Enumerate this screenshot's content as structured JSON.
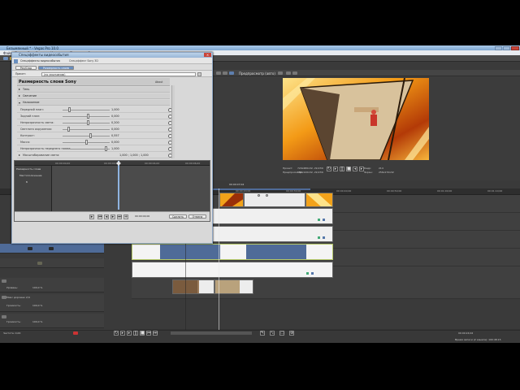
{
  "app": {
    "title": "Безымянный * - Vegas Pro 10.0",
    "menu": [
      "Файл",
      "Правка",
      "Вид",
      "Вставка",
      "Инструменты",
      "Параметры",
      "Справка"
    ]
  },
  "preview": {
    "label": "Предпросмотр (авто)",
    "info": {
      "project_label": "Проект:",
      "project_value": "720x480x32, 29,970i",
      "preview_label": "Предпросмотр:",
      "preview_value": "180x120x32, 29,970i",
      "frame_label": "Кадр:",
      "frame_value": "214",
      "display_label": "Экран:",
      "display_value": "256x170x32"
    }
  },
  "timeline": {
    "ticks": [
      "00:00:00;00",
      "00:00:10;00",
      "00:00:20;00",
      "00:00:30;00",
      "00:00:40;00",
      "00:00:50;00",
      "00:01:00;00",
      "00:01:10;00"
    ],
    "position_readout": "00:00:07;04",
    "tracks": [
      {
        "label": "Уровень:",
        "value": "100,0 %"
      },
      {
        "label": "Уровень:",
        "value": "100,0 %"
      },
      {
        "label": "Уровень:",
        "value": "100,0 %"
      },
      {
        "label": "Уровень:",
        "value": "100,0 %"
      }
    ],
    "audio": [
      {
        "name": "Микс дорожек 2/4",
        "label": "Громкость:",
        "value": "100,0 %"
      },
      {
        "name": "",
        "label": "Громкость:",
        "value": "100,0 %"
      }
    ]
  },
  "dialog": {
    "title": "Спецэффекты видеособытия",
    "close": "×",
    "chain_label": "Спецэффекты видеособытия",
    "plugin_name": "Спецэффект Sony 3D",
    "tabs": [
      "Pan/Crop",
      "Размерность слоев"
    ],
    "preset_label": "Пресет:",
    "preset_value": "(по умолчанию)",
    "header": "Размерность слоев Sony",
    "about": "About",
    "sections": {
      "shadows": "Тень",
      "glow": "Свечение",
      "layering": "Наложение"
    },
    "params": [
      {
        "label": "Передний план:",
        "value": "1,000",
        "pos": 0.12
      },
      {
        "label": "Задний план:",
        "value": "0,000",
        "pos": 0.55
      },
      {
        "label": "Непрозрачность света:",
        "value": "0,200",
        "pos": 0.55
      },
      {
        "label": "Светлота окружения:",
        "value": "0,000",
        "pos": 0.1
      },
      {
        "label": "Контраст:",
        "value": "0,557",
        "pos": 0.6
      },
      {
        "label": "Масса:",
        "value": "0,000",
        "pos": 0.5
      },
      {
        "label": "Непрозрачность переднего плана:",
        "value": "1,000",
        "pos": 0.95
      }
    ],
    "scale_label": "Масштабирование света:",
    "scale_value": "1,000 ; 1,000 ; 1,000",
    "kf": {
      "ruler_ticks": [
        "00:00:00,00",
        "00:00:02,00",
        "00:00:04,00",
        "00:00:06,00"
      ],
      "rows": [
        "Размерность слоев",
        "Местоположение",
        "Б"
      ],
      "time": "00:00:04;00",
      "ok": "Сделать",
      "cancel": "Отмена"
    }
  },
  "status_bar": {
    "rate_label": "Частота: 0,00",
    "position": "00:00:24;02",
    "render_time": "Время записи (2 канала): 100:48:15"
  },
  "colors": {
    "background": "#3a3a3a",
    "dialog": "#d8d8d8",
    "accent_blue": "#4f6b98",
    "video_orange": "#f1a018"
  }
}
